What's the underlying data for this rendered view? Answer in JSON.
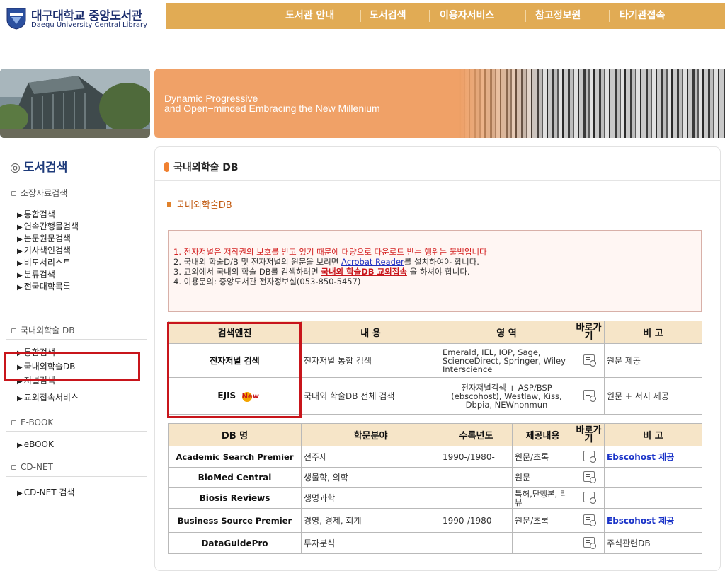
{
  "logo": {
    "kr": "대구대학교 중앙도서관",
    "en": "Daegu University Central Library",
    "icon": "university-emblem-icon"
  },
  "topnav": [
    "도서관 안내",
    "도서검색",
    "이용자서비스",
    "참고정보원",
    "타기관접속"
  ],
  "banner": {
    "line1": "Dynamic Progressive",
    "line2": "and Open−minded Embracing the New Millenium"
  },
  "sidebar": {
    "title": "도서검색",
    "title_icon": "◎",
    "sections": [
      {
        "label": "소장자료검색",
        "items": [
          "통합검색",
          "연속간행물검색",
          "논문원문검색",
          "기사색인검색",
          "비도서리스트",
          "분류검색",
          "전국대학목록"
        ]
      },
      {
        "label": "국내외학술 DB",
        "items": [
          "통합검색",
          "국내외학술DB",
          "저널검색",
          "교외접속서비스"
        ]
      },
      {
        "label": "E-BOOK",
        "items": [
          "eBOOK"
        ]
      },
      {
        "label": "CD-NET",
        "items": [
          "CD-NET 검색"
        ]
      }
    ]
  },
  "page": {
    "title": "국내외학술 DB",
    "subheading": "국내외학술DB"
  },
  "notice": {
    "l1": "1. 전자저널은 저작권의 보호를 받고 있기 때문에 대량으로 다운로드 받는 행위는 불법입니다",
    "l2_a": "2. 국내외 학술D/B 및 전자저널의 원문을 보려면 ",
    "l2_link": "Acrobat Reader",
    "l2_b": "를 설치하여야 합니다.",
    "l3_a": "3. 교외에서 국내외 학술 DB를 검색하려면 ",
    "l3_link": "국내외 학술DB 교외접속",
    "l3_b": " 을 하셔야 합니다.",
    "l4": "4. 이용문의: 중앙도서관 전자정보실(053-850-5457)"
  },
  "engine_table": {
    "headers": [
      "검색엔진",
      "내 용",
      "영 역",
      "바로가기",
      "비 고"
    ],
    "rows": [
      {
        "name": "전자저널 검색",
        "content": "전자저널 통합 검색",
        "scope": "Emerald, IEL, IOP, Sage, ScienceDirect, Springer, Wiley Interscience",
        "note": "원문 제공"
      },
      {
        "name": "EJIS",
        "badge": "New",
        "content": "국내외 학술DB 전체 검색",
        "scope": "전자저널검색 + ASP/BSP (ebscohost), Westlaw, Kiss, Dbpia, NEWnonmun",
        "note": "원문 + 서지 제공"
      }
    ]
  },
  "db_table": {
    "headers": [
      "DB 명",
      "학문분야",
      "수록년도",
      "제공내용",
      "바로가기",
      "비 고"
    ],
    "rows": [
      {
        "name": "Academic Search Premier",
        "field": "전주제",
        "years": "1990-/1980-",
        "provides": "원문/초록",
        "note": "Ebscohost 제공"
      },
      {
        "name": "BioMed Central",
        "field": "생물학, 의학",
        "years": "",
        "provides": "원문",
        "note": ""
      },
      {
        "name": "Biosis Reviews",
        "field": "생명과학",
        "years": "",
        "provides": "특허,단행본, 리뷰",
        "note": ""
      },
      {
        "name": "Business Source Premier",
        "field": "경영, 경제, 회계",
        "years": "1990-/1980-",
        "provides": "원문/초록",
        "note": "Ebscohost 제공"
      },
      {
        "name": "DataGuidePro",
        "field": "투자분석",
        "years": "",
        "provides": "",
        "note": "주식관련DB"
      }
    ]
  },
  "colors": {
    "nav": "#e1ab54",
    "banner": "#f0a167",
    "highlight": "#c8151b",
    "table_header": "#f6e5c8"
  }
}
